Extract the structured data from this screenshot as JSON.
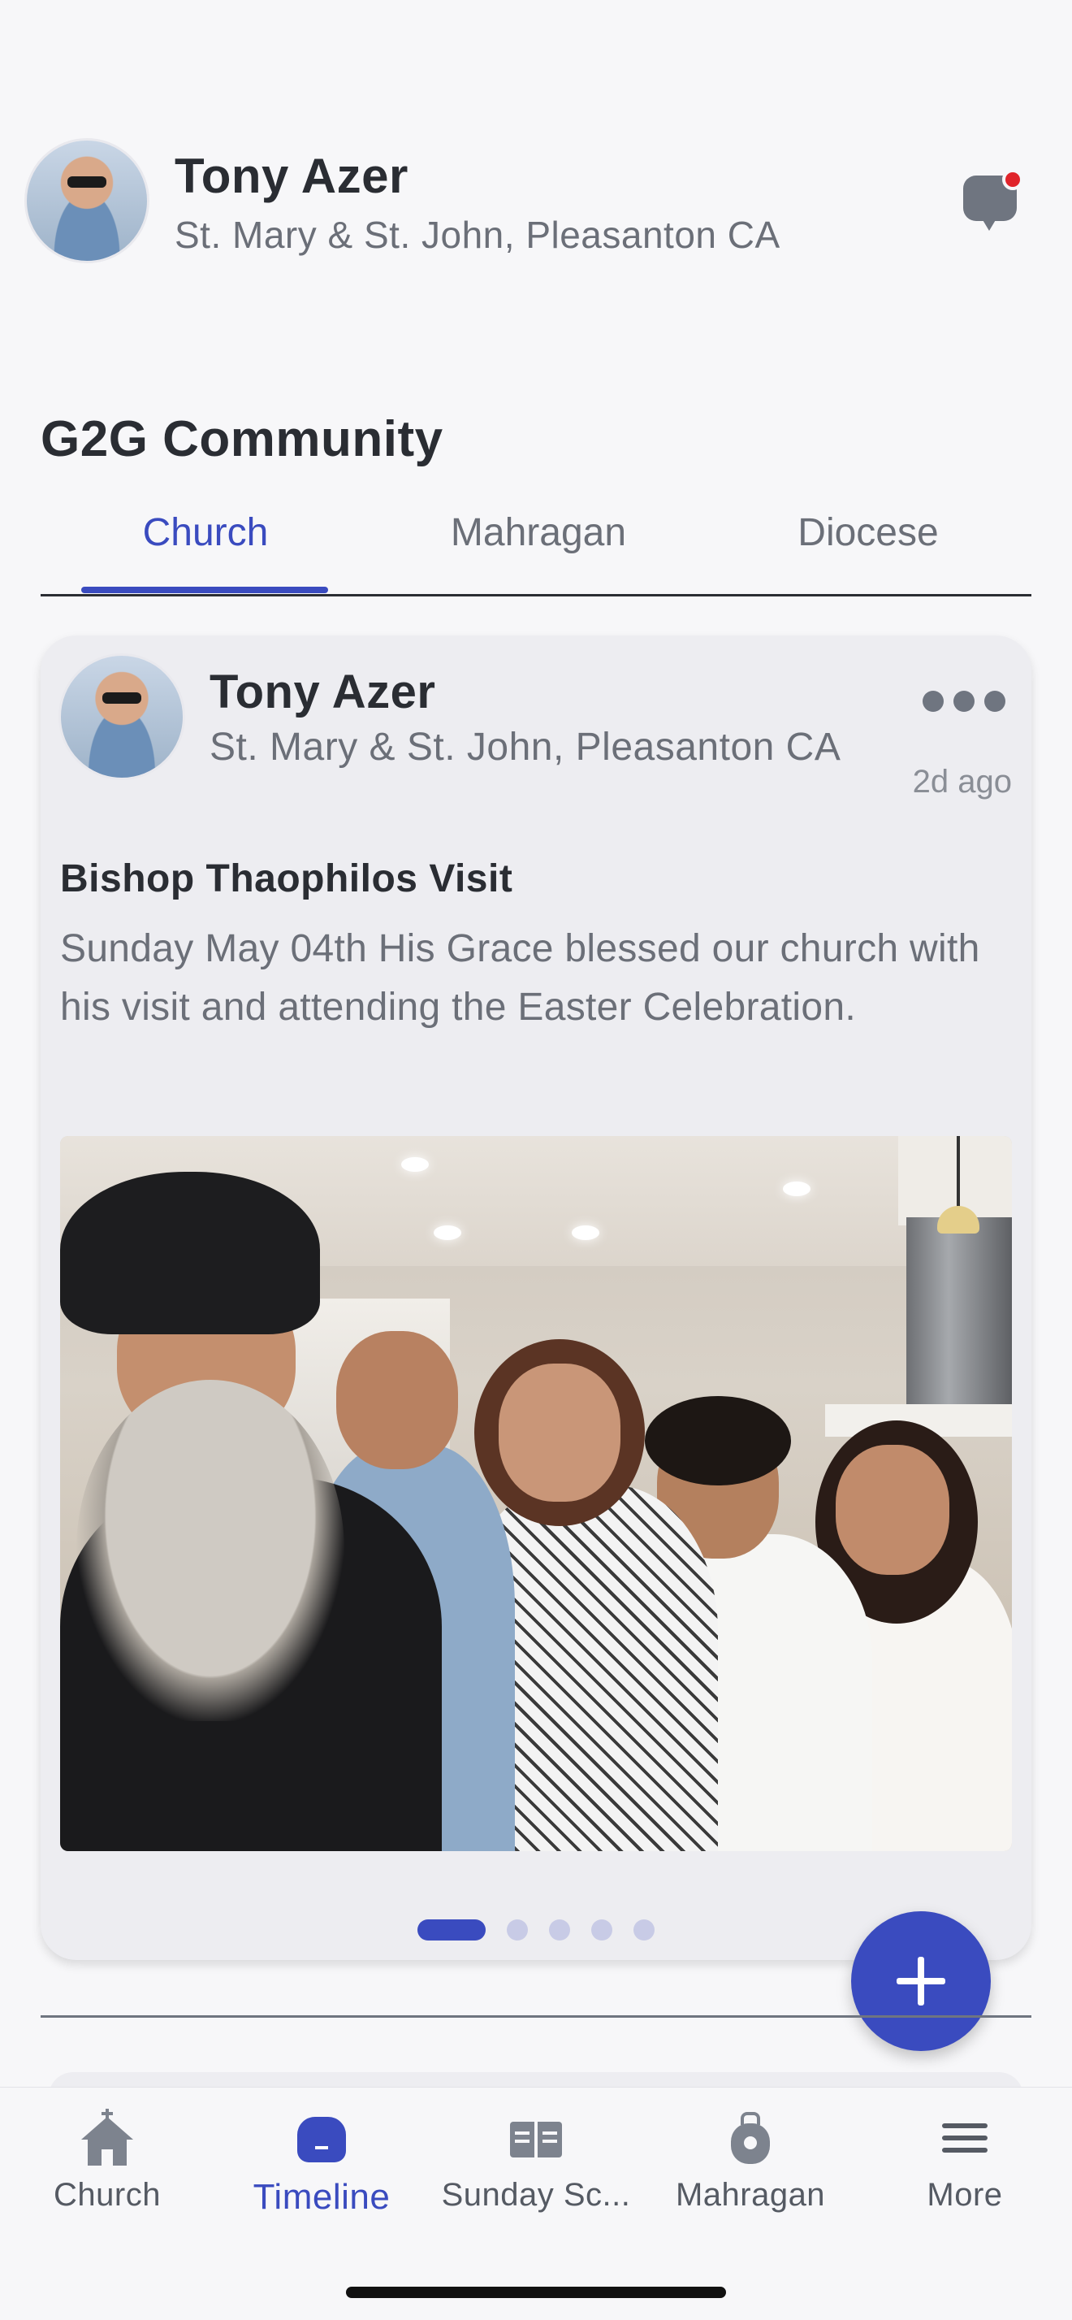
{
  "header": {
    "user_name": "Tony Azer",
    "church": "St. Mary & St. John, Pleasanton CA",
    "notification_dot_color": "#e0242b"
  },
  "community": {
    "title": "G2G Community",
    "tabs": [
      {
        "label": "Church",
        "active": true
      },
      {
        "label": "Mahragan",
        "active": false
      },
      {
        "label": "Diocese",
        "active": false
      }
    ]
  },
  "post": {
    "author": "Tony Azer",
    "church": "St. Mary & St. John, Pleasanton CA",
    "time": "2d ago",
    "title": "Bishop Thaophilos Visit",
    "body": "Sunday May 04th His Grace blessed our church with his visit and attending the Easter Celebration.",
    "image_index": 1,
    "image_count": 5
  },
  "fab": {
    "icon": "plus-icon"
  },
  "bottom_nav": [
    {
      "label": "Church",
      "icon": "church-icon",
      "active": false
    },
    {
      "label": "Timeline",
      "icon": "timeline-icon",
      "active": true
    },
    {
      "label": "Sunday Sc...",
      "icon": "book-icon",
      "active": false
    },
    {
      "label": "Mahragan",
      "icon": "medal-icon",
      "active": false
    },
    {
      "label": "More",
      "icon": "menu-icon",
      "active": false
    }
  ],
  "colors": {
    "accent": "#3a4bbf",
    "background": "#f7f7f9",
    "card": "#ededf1"
  }
}
